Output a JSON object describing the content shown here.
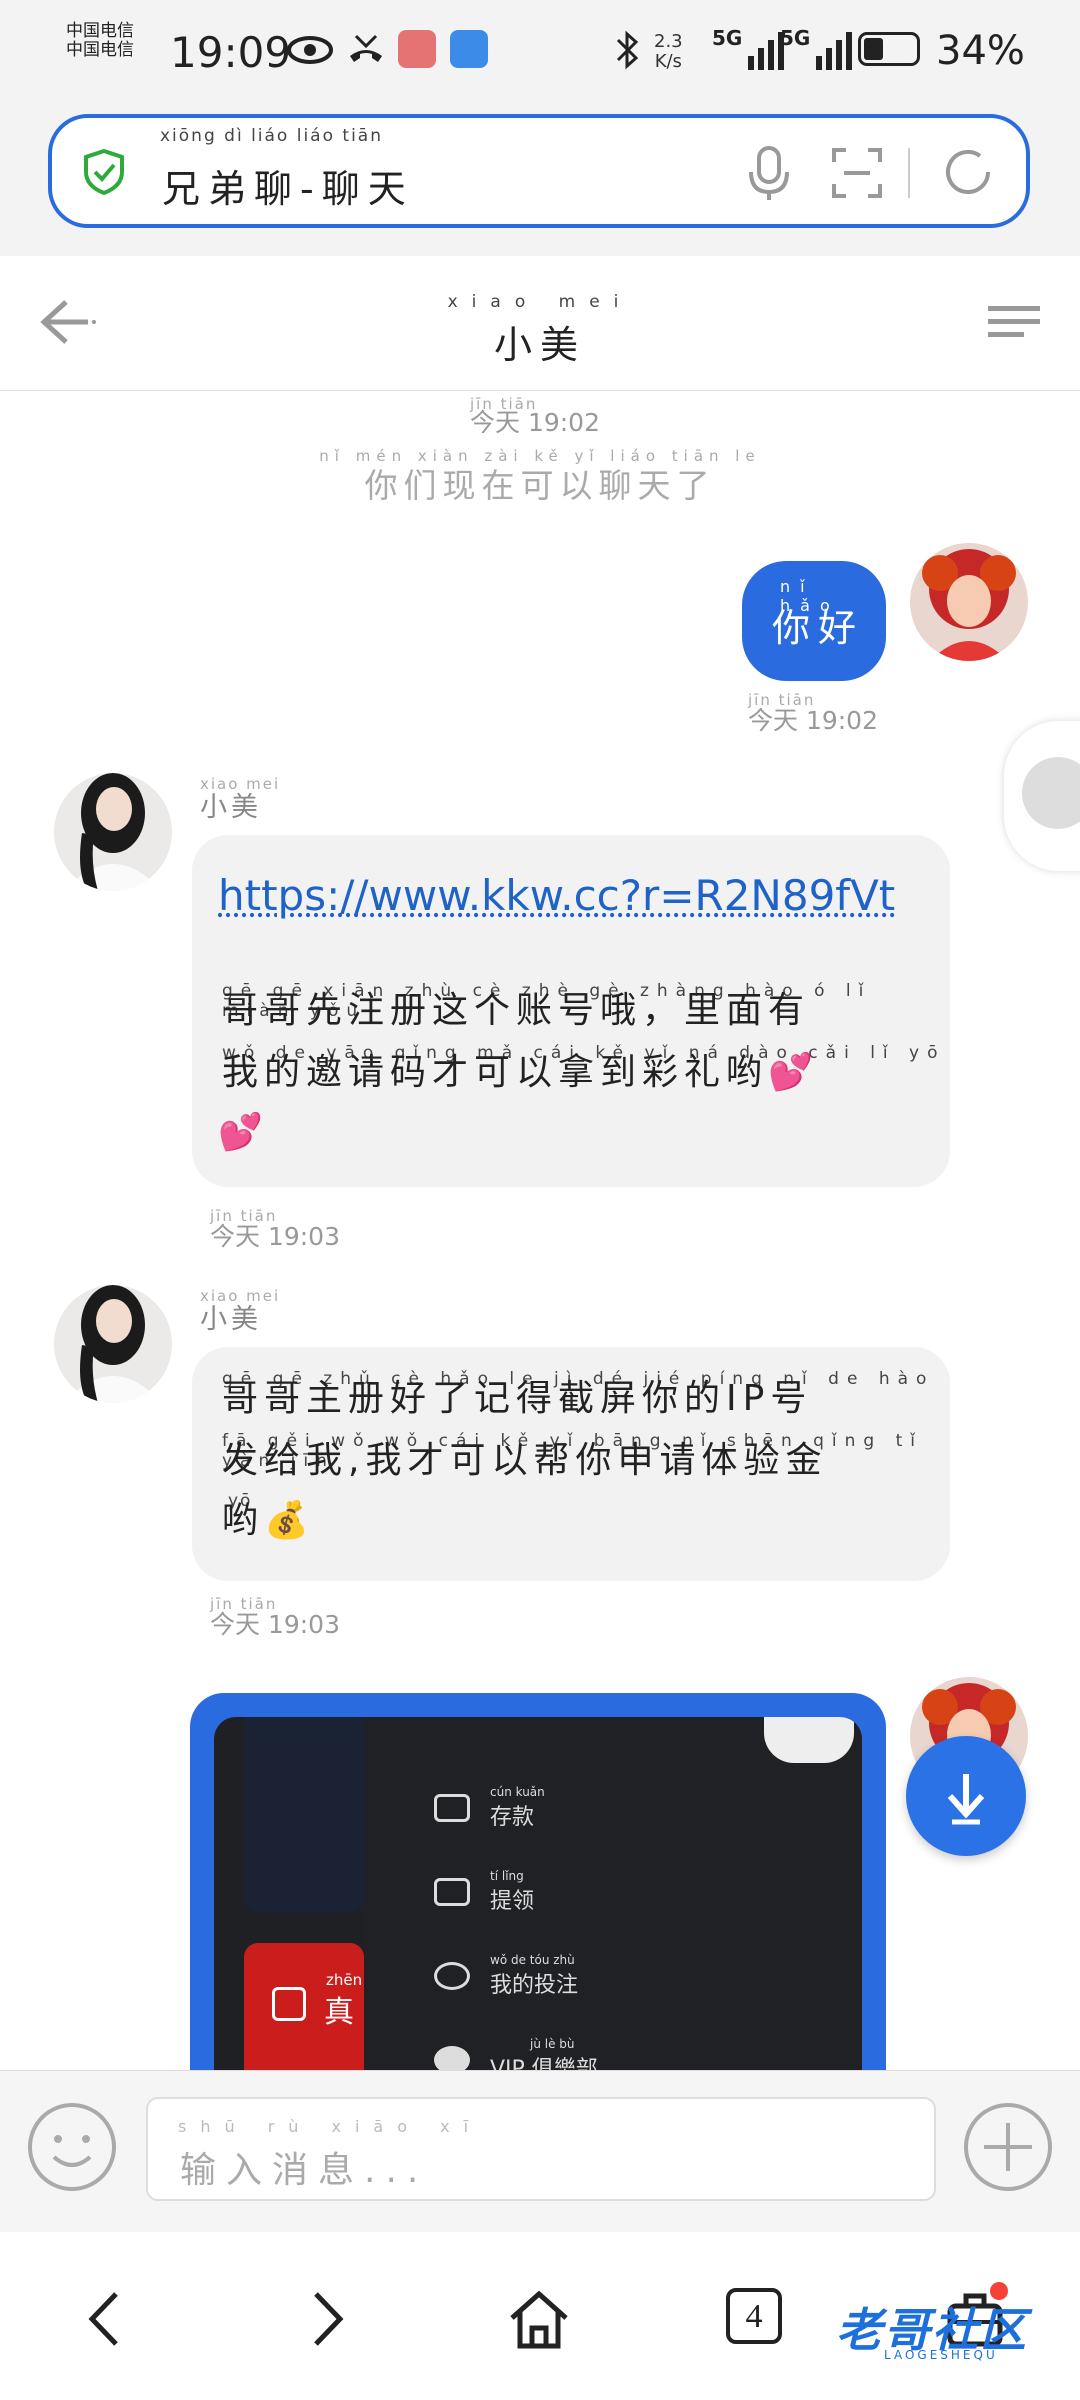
{
  "status_bar": {
    "carrier_1": "中国电信",
    "carrier_2": "中国电信",
    "time": "19:09",
    "net_speed_value": "2.3",
    "net_speed_unit": "K/s",
    "signal_1_label": "5G",
    "signal_2_label": "5G",
    "battery_percent": "34%",
    "battery_level": 0.34
  },
  "address_bar": {
    "pinyin": "xiōng dì liáo   liáo tiān",
    "url_text": "兄弟聊-聊天"
  },
  "header": {
    "title_pinyin": "xiao mei",
    "title": "小美"
  },
  "chat": {
    "system": {
      "time_pinyin": "jīn tiān",
      "time": "今天 19:02",
      "text_pinyin": "nǐ mén xiàn zài kě yǐ liáo tiān le",
      "text": "你们现在可以聊天了"
    },
    "msg_out_1": {
      "pinyin": "nǐ hǎo",
      "text": "你好",
      "time_pinyin": "jīn tiān",
      "time": "今天 19:02"
    },
    "msg_in_1": {
      "sender_pinyin": "xiao mei",
      "sender": "小美",
      "link": "https://www.kkw.cc?r=R2N89fVt",
      "line1_pinyin": "gē gē xiān zhù cè zhè gè zhàng hào ó   lǐ miàn yǒu",
      "line1": "哥哥先注册这个账号哦，里面有",
      "line2_pinyin": "wǒ de yāo qǐng mǎ cái kě yǐ ná dào cǎi lǐ yō",
      "line2": "我的邀请码才可以拿到彩礼哟💕",
      "line3": "💕",
      "time_pinyin": "jīn tiān",
      "time": "今天 19:03"
    },
    "msg_in_2": {
      "sender_pinyin": "xiao mei",
      "sender": "小美",
      "line1_pinyin": "gē gē zhǔ cè hǎo le jì dé jié píng nǐ de     hào",
      "line1": "哥哥主册好了记得截屏你的IP号",
      "line2_pinyin": "fā gěi wǒ   wǒ cái kě yǐ bāng nǐ shēn qǐng tǐ yàn jīn",
      "line2": "发给我,我才可以帮你申请体验金",
      "line3_pinyin": "yō",
      "line3": "哟💰",
      "time_pinyin": "jīn tiān",
      "time": "今天 19:03"
    },
    "screenshot_menu": [
      {
        "icon": "wallet-icon",
        "pinyin": "cún kuǎn",
        "label": "存款"
      },
      {
        "icon": "card-icon",
        "pinyin": "tí lǐng",
        "label": "提领"
      },
      {
        "icon": "user-bet-icon",
        "pinyin": "wǒ de tóu zhù",
        "label": "我的投注"
      },
      {
        "icon": "vip-icon",
        "pinyin": "jù lè bù",
        "label": "VIP 俱樂部"
      }
    ],
    "screenshot_tile": {
      "pinyin": "zhēn",
      "label": "真"
    }
  },
  "input_bar": {
    "placeholder_pinyin": "shū rù xiāo xī",
    "placeholder": "输入消息..."
  },
  "nav_bar": {
    "tab_count": "4",
    "watermark": "老哥社区",
    "watermark_sub": "LAOGESHEQU"
  },
  "colors": {
    "accent": "#2a6be0",
    "bubble_in": "#f2f2f2",
    "link": "#1f62c8",
    "secure": "#2eaa3c"
  }
}
